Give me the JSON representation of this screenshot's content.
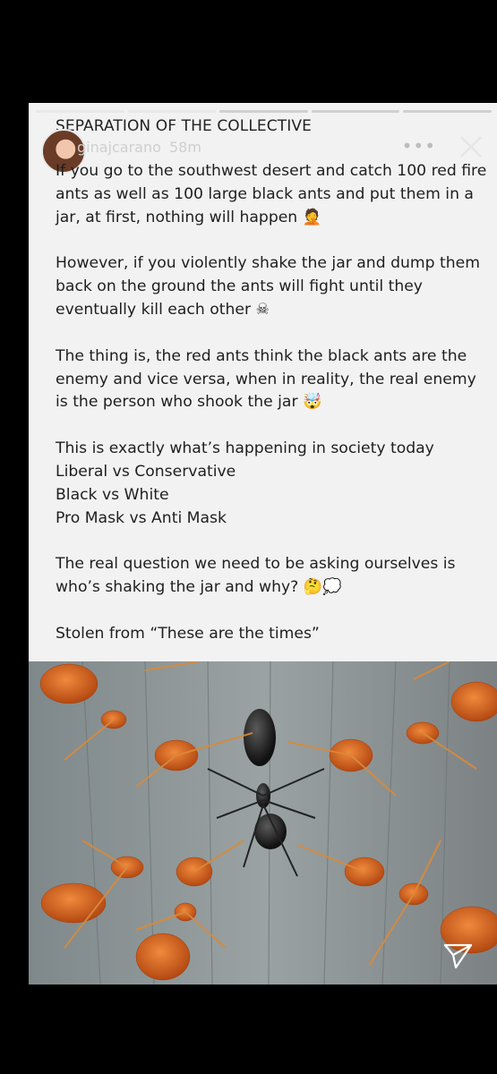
{
  "story": {
    "heading": "SEPARATION OF THE COLLECTIVE",
    "user": {
      "handle": "ginajcarano",
      "time": "58m"
    },
    "paragraphs": [
      "If you go to the southwest desert and catch 100 red fire ants as well as 100 large black ants and put them in a jar, at first, nothing will happen 🤦",
      "However, if you violently shake the jar and dump them back on the ground the ants will fight until they eventually kill each other ☠",
      "The thing is, the red ants think the black ants are the enemy and vice versa, when in reality, the real enemy is the person who shook the jar 🤯",
      "This is exactly what’s happening in society today\nLiberal vs Conservative\nBlack vs White\nPro Mask vs Anti Mask",
      "The real question we need to be asking ourselves is who’s shaking the jar and why? 🤔💭",
      "Stolen from “These are the times”"
    ],
    "icons": {
      "more": "more-dots-icon",
      "close": "close-icon",
      "send": "send-icon"
    },
    "colors": {
      "card": "#f2f2f2",
      "text": "#1f1f1f",
      "background": "#000000"
    }
  }
}
